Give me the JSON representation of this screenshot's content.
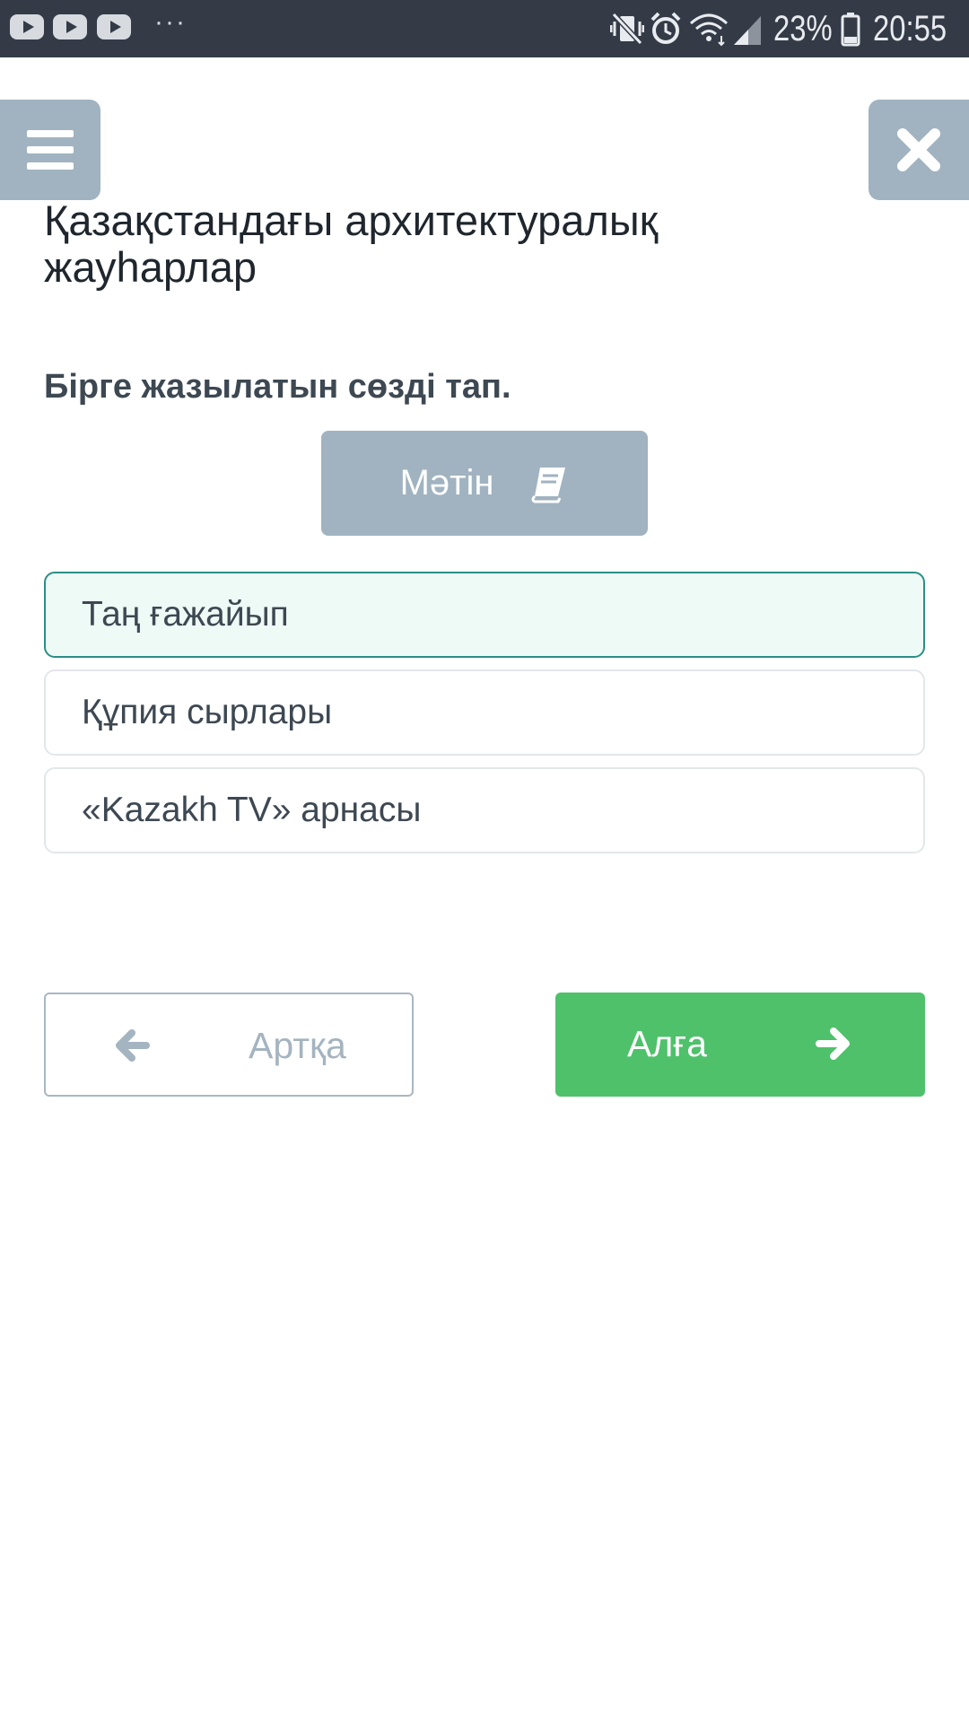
{
  "status_bar": {
    "notification_icons": [
      "youtube-icon",
      "youtube-icon",
      "youtube-icon"
    ],
    "more": "···",
    "battery_percent": "23%",
    "time": "20:55",
    "icons": [
      "vibrate-icon",
      "alarm-icon",
      "wifi-icon",
      "signal-icon",
      "battery-icon"
    ]
  },
  "header": {
    "menu_icon": "hamburger-menu-icon",
    "close_icon": "close-icon"
  },
  "main": {
    "title": "Қазақстандағы архитектуралық жауһарлар",
    "question": "Бірге жазылатын сөзді тап.",
    "text_button": {
      "label": "Мәтін",
      "icon": "book-icon"
    },
    "options": [
      {
        "label": "Таң ғажайып",
        "selected": true
      },
      {
        "label": "Құпия сырлары",
        "selected": false
      },
      {
        "label": "«Kazakh TV» арнасы",
        "selected": false
      }
    ]
  },
  "navigation": {
    "back_label": "Артқа",
    "next_label": "Алға"
  },
  "colors": {
    "status_bar": "#343b47",
    "muted_button": "#a1b3c0",
    "selected_border": "#2a8f86",
    "selected_fill": "#eefaf6",
    "next_button": "#4fc16b"
  }
}
